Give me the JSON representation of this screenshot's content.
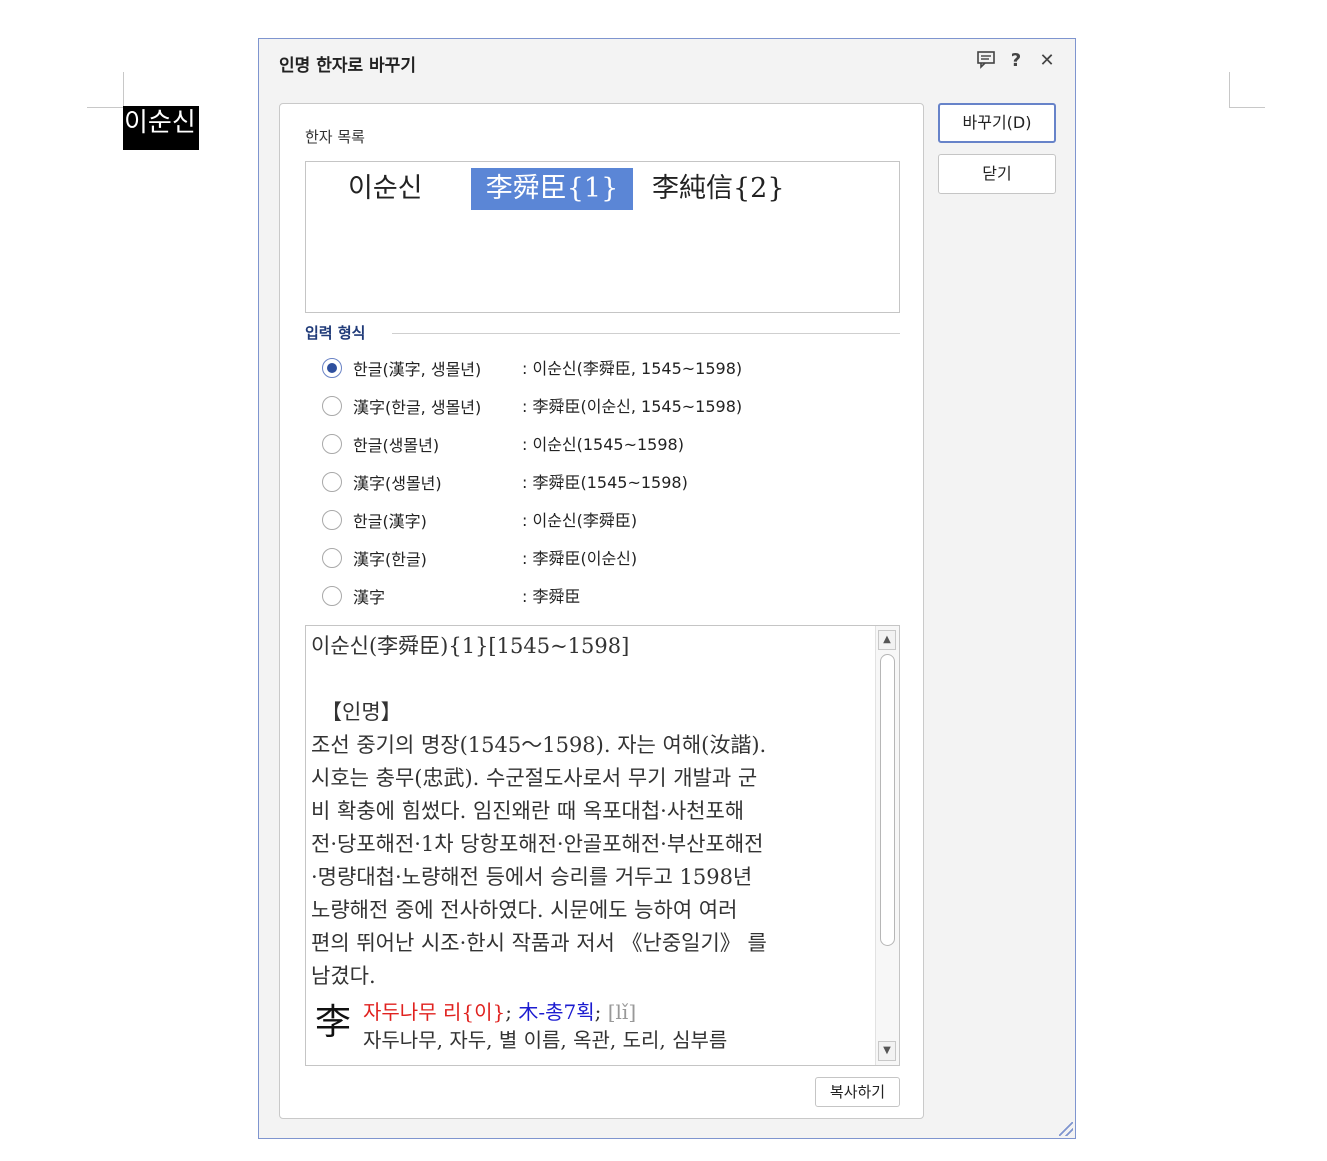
{
  "document": {
    "selected_text": "이순신"
  },
  "dialog": {
    "title": "인명 한자로 바꾸기",
    "icons": {
      "comment": "comment-icon",
      "help": "help-icon",
      "close": "close-icon"
    },
    "buttons": {
      "replace": "바꾸기(D)",
      "close": "닫기",
      "copy": "복사하기"
    },
    "hanja_list_label": "한자 목록",
    "candidates": [
      "이순신",
      "李舜臣{1}",
      "李純信{2}"
    ],
    "selected_candidate_index": 1,
    "format_section_title": "입력 형식",
    "formats": [
      {
        "label": "한글(漢字, 생몰년)",
        "example": ": 이순신(李舜臣, 1545~1598)",
        "checked": true
      },
      {
        "label": "漢字(한글, 생몰년)",
        "example": ": 李舜臣(이순신, 1545~1598)",
        "checked": false
      },
      {
        "label": "한글(생몰년)",
        "example": ": 이순신(1545~1598)",
        "checked": false
      },
      {
        "label": "漢字(생몰년)",
        "example": ": 李舜臣(1545~1598)",
        "checked": false
      },
      {
        "label": "한글(漢字)",
        "example": ": 이순신(李舜臣)",
        "checked": false
      },
      {
        "label": "漢字(한글)",
        "example": ": 李舜臣(이순신)",
        "checked": false
      },
      {
        "label": "漢字",
        "example": ": 李舜臣",
        "checked": false
      }
    ],
    "info": {
      "header": "이순신(李舜臣){1}[1545~1598]",
      "category": "【인명】",
      "description_lines": [
        "조선 중기의 명장(1545～1598). 자는 여해(汝諧).",
        "시호는 충무(忠武). 수군절도사로서 무기 개발과 군",
        "비 확충에 힘썼다. 임진왜란 때 옥포대첩·사천포해",
        "전·당포해전·1차 당항포해전·안골포해전·부산포해전",
        "·명량대첩·노량해전 등에서 승리를 거두고 1598년",
        "노량해전 중에 전사하였다. 시문에도 능하여 여러",
        "편의 뛰어난 시조·한시 작품과 저서 《난중일기》 를",
        "남겼다."
      ],
      "char": "李",
      "char_meaning": "자두나무 리{이}",
      "char_sep1": "; ",
      "char_radical": "木-총7획",
      "char_sep2": "; ",
      "char_pinyin": "[lǐ]",
      "char_defs": "자두나무, 자두, 별 이름, 옥관, 도리, 심부름"
    }
  }
}
